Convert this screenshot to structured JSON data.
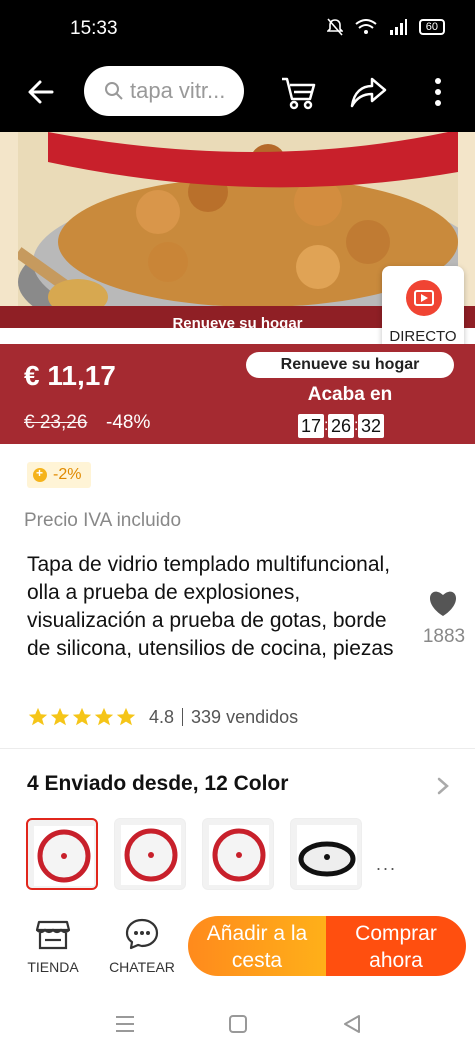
{
  "status_bar": {
    "time": "15:33",
    "battery": "60"
  },
  "search": {
    "placeholder": "tapa vitr..."
  },
  "hero": {
    "banner_text": "Renueve su hogar",
    "live_label": "DIRECTO"
  },
  "price": {
    "current": "€ 11,17",
    "original": "€ 23,26",
    "discount": "-48%",
    "promo_label": "Renueve su hogar",
    "ends_label": "Acaba en",
    "countdown": {
      "hours": "17",
      "minutes": "26",
      "seconds": "32"
    }
  },
  "product": {
    "coupon": "-2%",
    "vat_note": "Precio IVA incluido",
    "title": "Tapa de vidrio templado multifuncional, olla a prueba de explosiones, visualización a prueba de gotas, borde de silicona, utensilios de cocina, piezas",
    "favorites": "1883",
    "rating": "4.8",
    "sold": "339 vendidos",
    "stars": 5
  },
  "variants": {
    "header": "4 Enviado desde, 12 Color",
    "more": "...",
    "items": [
      {
        "kind": "red-lid",
        "selected": true
      },
      {
        "kind": "red-lid",
        "selected": false
      },
      {
        "kind": "red-lid",
        "selected": false
      },
      {
        "kind": "black-lid",
        "selected": false
      }
    ]
  },
  "actions": {
    "shop_label": "TIENDA",
    "chat_label": "CHATEAR",
    "add_to_cart": "Añadir a la cesta",
    "buy_now": "Comprar ahora"
  },
  "colors": {
    "accent": "#a52a31",
    "cart_orange": "#ffa21a",
    "buy_red": "#ff4f0f",
    "star": "#f5c518"
  },
  "icons": [
    "back-arrow-icon",
    "search-icon",
    "cart-icon",
    "share-icon",
    "more-vertical-icon",
    "play-icon",
    "live-icon",
    "heart-icon",
    "star-icon",
    "chevron-right-icon",
    "store-icon",
    "chat-icon"
  ]
}
